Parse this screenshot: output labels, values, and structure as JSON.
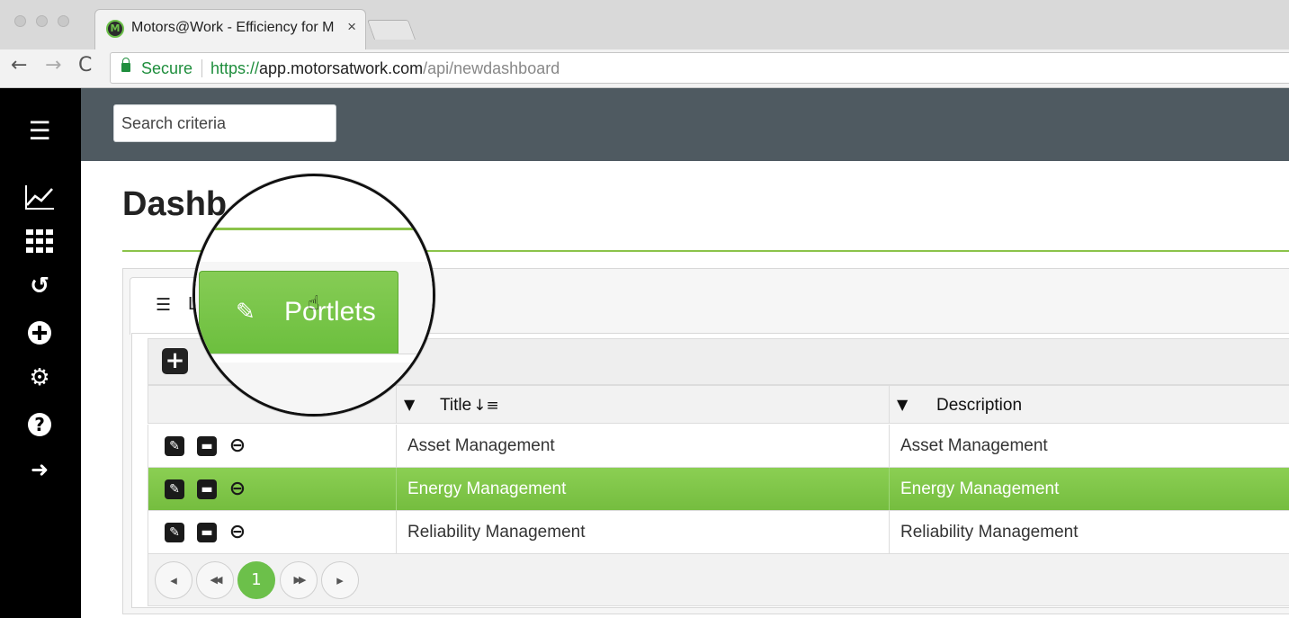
{
  "browser": {
    "tab_title": "Motors@Work - Efficiency for M",
    "tab_close": "×",
    "favicon": "M",
    "secure_label": "Secure",
    "url_scheme": "https://",
    "url_host": "app.motorsatwork.com",
    "url_path": "/api/newdashboard"
  },
  "header": {
    "search_placeholder": "Search criteria"
  },
  "sidebar": {
    "items": [
      "menu-icon",
      "chart-icon",
      "grid-icon",
      "history-icon",
      "add-circle-icon",
      "settings-icon",
      "help-icon",
      "logout-icon"
    ]
  },
  "page": {
    "title": "Dashb",
    "tab_list_label": "L",
    "tab_portlets_label": "Portlets"
  },
  "grid": {
    "add_label": "+",
    "columns": [
      {
        "label": "Title",
        "sorted": true
      },
      {
        "label": "Description",
        "sorted": false
      }
    ],
    "rows": [
      {
        "title": "Asset Management",
        "description": "Asset Management",
        "selected": false
      },
      {
        "title": "Energy Management",
        "description": "Energy Management",
        "selected": true
      },
      {
        "title": "Reliability Management",
        "description": "Reliability Management",
        "selected": false
      }
    ]
  },
  "pager": {
    "current_page": "1",
    "prev": "◂",
    "first": "◀◀",
    "last": "▶▶",
    "next": "▸"
  },
  "colors": {
    "accent": "#6cc04a",
    "header_bg": "#4f5a61",
    "sidebar_bg": "#000000"
  }
}
